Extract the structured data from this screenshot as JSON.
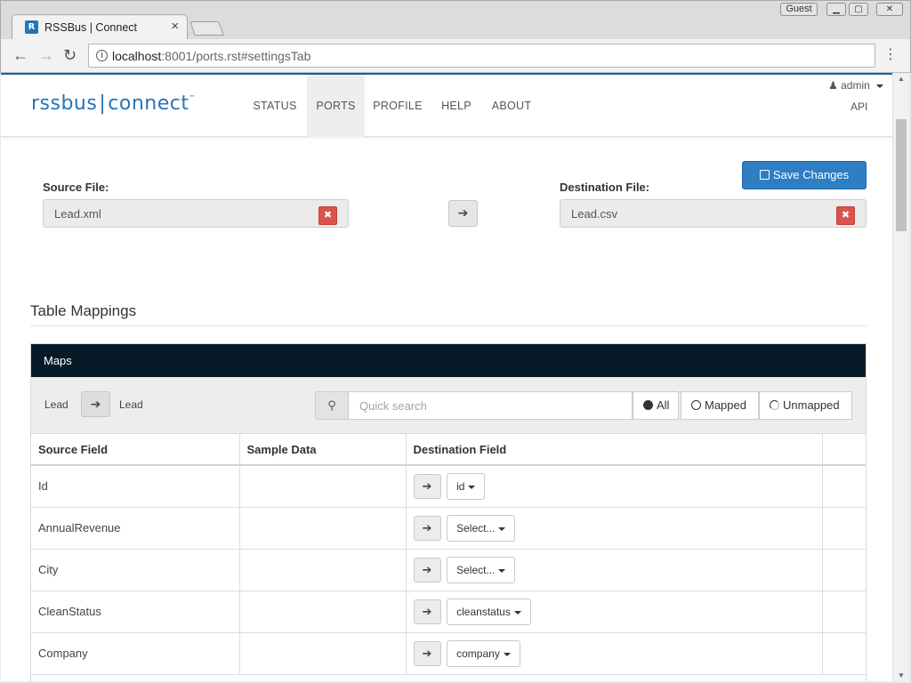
{
  "browser": {
    "tab_title": "RSSBus | Connect",
    "tab_close": "×",
    "profile": "Guest",
    "url_host": "localhost",
    "url_rest": ":8001/ports.rst#settingsTab"
  },
  "app": {
    "logo_left": "rssbus",
    "logo_right": "connect",
    "logo_tm": "™",
    "nav": [
      "STATUS",
      "PORTS",
      "PROFILE",
      "HELP",
      "ABOUT"
    ],
    "active_nav": "PORTS",
    "user": "admin",
    "api": "API",
    "save_label": "Save Changes"
  },
  "files": {
    "source_label": "Source File:",
    "source_value": "Lead.xml",
    "destination_label": "Destination File:",
    "destination_value": "Lead.csv"
  },
  "mappings": {
    "section_title": "Table Mappings",
    "panel_title": "Maps",
    "source_table": "Lead",
    "destination_table": "Lead",
    "search_placeholder": "Quick search",
    "filters": [
      "All",
      "Mapped",
      "Unmapped"
    ],
    "selected_filter": "All",
    "columns": [
      "Source Field",
      "Sample Data",
      "Destination Field",
      ""
    ],
    "rows": [
      {
        "source": "Id",
        "sample": "",
        "destination": "id"
      },
      {
        "source": "AnnualRevenue",
        "sample": "",
        "destination": "Select..."
      },
      {
        "source": "City",
        "sample": "",
        "destination": "Select..."
      },
      {
        "source": "CleanStatus",
        "sample": "",
        "destination": "cleanstatus"
      },
      {
        "source": "Company",
        "sample": "",
        "destination": "company"
      }
    ]
  },
  "icons": {
    "arrow": "arrow-right-icon",
    "search": "search-icon",
    "clear": "clear-icon",
    "floppy": "floppy-icon",
    "user": "user-icon"
  },
  "colors": {
    "brand": "#2873b8",
    "save_button": "#2d7ec2",
    "panel_header": "#071a27",
    "clear_button": "#d9534f"
  }
}
